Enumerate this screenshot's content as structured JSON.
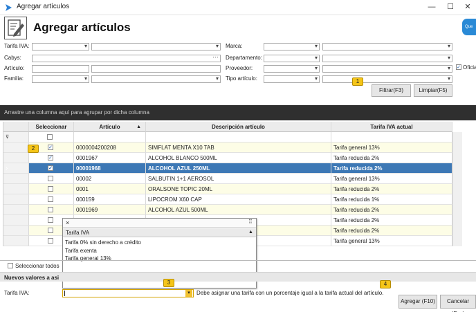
{
  "window": {
    "title": "Agregar artículos"
  },
  "header": {
    "title": "Agregar artículos",
    "help_text": "Que"
  },
  "filters": {
    "tarifa_iva_label": "Tarifa IVA:",
    "cabys_label": "Cabys:",
    "articulo_label": "Artículo:",
    "familia_label": "Familia:",
    "marca_label": "Marca:",
    "departamento_label": "Departamento:",
    "proveedor_label": "Proveedor:",
    "tipo_articulo_label": "Tipo artículo:",
    "oficial_label": "Oficial",
    "filtrar_label": "Filtrar(F3)",
    "limpiar_label": "Limpiar(F5)"
  },
  "grid": {
    "group_hint": "Arrastre una columna aquí para agrupar por dicha columna",
    "columns": [
      "Seleccionar",
      "Artículo",
      "Descripción artículo",
      "Tarifa IVA actual"
    ],
    "sort_indicator": "▲",
    "rows": [
      {
        "codigo": "0000004200208",
        "descripcion": "SIMFLAT MENTA X10 TAB",
        "tarifa": "Tarifa general 13%",
        "checked": true
      },
      {
        "codigo": "0001967",
        "descripcion": "ALCOHOL BLANCO 500ML",
        "tarifa": "Tarifa reducida 2%",
        "checked": true
      },
      {
        "codigo": "00001968",
        "descripcion": "ALCOHOL AZUL 250ML",
        "tarifa": "Tarifa reducida 2%",
        "checked": true
      },
      {
        "codigo": "00002",
        "descripcion": "SALBUTIN 1+1 AEROSOL",
        "tarifa": "Tarifa general 13%",
        "checked": false
      },
      {
        "codigo": "0001",
        "descripcion": "ORALSONE TOPIC 20ML",
        "tarifa": "Tarifa reducida 2%",
        "checked": false
      },
      {
        "codigo": "000159",
        "descripcion": "LIPOCROM X60 CAP",
        "tarifa": "Tarifa reducida 1%",
        "checked": false
      },
      {
        "codigo": "0001969",
        "descripcion": "ALCOHOL AZUL 500ML",
        "tarifa": "Tarifa reducida 2%",
        "checked": false
      },
      {
        "codigo": "",
        "descripcion": "",
        "tarifa": "Tarifa reducida 2%",
        "checked": false
      },
      {
        "codigo": "",
        "descripcion": "",
        "tarifa": "Tarifa reducida 2%",
        "checked": false
      },
      {
        "codigo": "",
        "descripcion": "",
        "tarifa": "Tarifa general 13%",
        "checked": false
      }
    ],
    "row_indicator": "›"
  },
  "popup": {
    "close": "×",
    "header": "Tarifa IVA",
    "options": [
      "Tarifa 0% sin derecho a crédito",
      "Tarifa exenta",
      "Tarifa general 13%"
    ]
  },
  "bottom": {
    "seleccionar_todos_label": "Seleccionar todos",
    "nuevos_valores_label": "Nuevos valores a asi",
    "tarifa_iva_label": "Tarifa IVA:",
    "hint_text": "Debe asignar una tarifa con un porcentaje igual a la tarifa actual del artículo.",
    "agregar_label": "Agregar (F10)",
    "cancelar_label": "Cancelar (Esc)"
  },
  "callouts": [
    "1",
    "2",
    "3",
    "4"
  ],
  "colors": {
    "selected_row": "#3d78b5",
    "callout": "#f5c518",
    "group_bar": "#2f2f2f",
    "help_badge": "#2a8ad6"
  }
}
